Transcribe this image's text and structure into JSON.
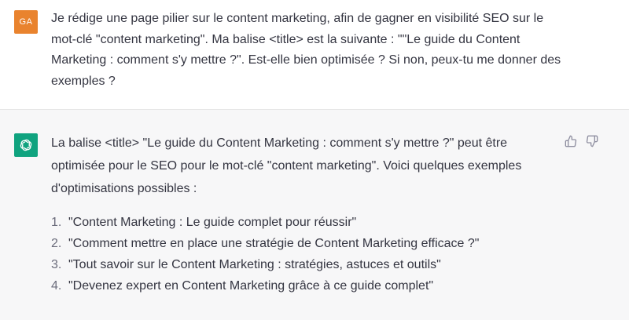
{
  "user_message": {
    "avatar_initials": "GA",
    "avatar_color": "#e9832e",
    "text": "Je rédige une page pilier sur le content marketing, afin de gagner en visibilité SEO sur le mot-clé \"content marketing\". Ma balise <title> est la suivante : \"\"Le guide du Content Marketing : comment s'y mettre ?\". Est-elle bien optimisée ? Si non, peux-tu me donner des exemples ?"
  },
  "assistant_message": {
    "avatar_icon": "openai-logo-icon",
    "avatar_color": "#10a37f",
    "intro": "La balise <title> \"Le guide du Content Marketing : comment s'y mettre ?\" peut être optimisée pour le SEO pour le mot-clé \"content marketing\". Voici quelques exemples d'optimisations possibles :",
    "examples": [
      {
        "num": "1.",
        "text": "\"Content Marketing : Le guide complet pour réussir\""
      },
      {
        "num": "2.",
        "text": "\"Comment mettre en place une stratégie de Content Marketing efficace ?\""
      },
      {
        "num": "3.",
        "text": "\"Tout savoir sur le Content Marketing : stratégies, astuces et outils\""
      },
      {
        "num": "4.",
        "text": "\"Devenez expert en Content Marketing grâce à ce guide complet\""
      }
    ],
    "feedback_icons": [
      "thumbs-up-icon",
      "thumbs-down-icon"
    ]
  }
}
